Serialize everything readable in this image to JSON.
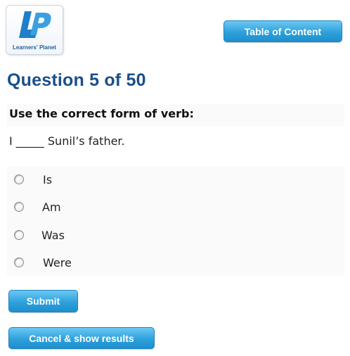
{
  "logo": {
    "text": "Learners' Planet",
    "icon": "lp-logo"
  },
  "header": {
    "toc_label": "Table of Content"
  },
  "question": {
    "heading": "Question 5 of 50",
    "instruction": "Use the correct form of verb:",
    "sentence": "I _____ Sunil’s father.",
    "options": [
      "Is",
      "Am",
      "Was",
      "Were"
    ]
  },
  "actions": {
    "submit_label": "Submit",
    "cancel_label": "Cancel & show results"
  },
  "colors": {
    "heading": "#1a4f8a",
    "button_top": "#6cc8f2",
    "button_bottom": "#1d8fcd"
  }
}
